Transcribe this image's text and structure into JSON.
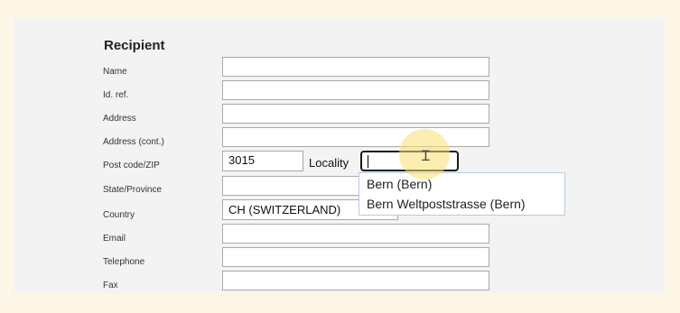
{
  "section": {
    "title": "Recipient"
  },
  "labels": {
    "name": "Name",
    "id_ref": "Id. ref.",
    "address": "Address",
    "address_cont": "Address (cont.)",
    "postcode": "Post code/ZIP",
    "state": "State/Province",
    "country": "Country",
    "email": "Email",
    "telephone": "Telephone",
    "fax": "Fax"
  },
  "values": {
    "name": "",
    "id_ref": "",
    "address": "",
    "address_cont": "",
    "postcode": "3015",
    "locality_label": "Locality",
    "locality": "",
    "state": "",
    "country": "CH (SWITZERLAND)",
    "email": "",
    "telephone": "",
    "fax": ""
  },
  "autocomplete": [
    "Bern (Bern)",
    "Bern Weltpoststrasse (Bern)"
  ],
  "cursor": {
    "glyph": "Ɪ"
  }
}
